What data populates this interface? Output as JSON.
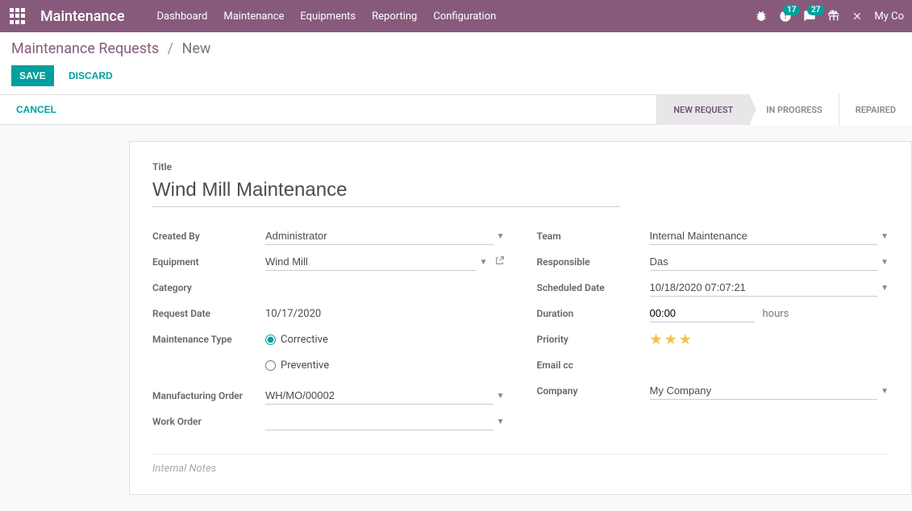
{
  "brand": "Maintenance",
  "nav": {
    "dashboard": "Dashboard",
    "maintenance": "Maintenance",
    "equipments": "Equipments",
    "reporting": "Reporting",
    "configuration": "Configuration"
  },
  "top_badges": {
    "activities": "17",
    "messages": "27"
  },
  "company": "My Co",
  "breadcrumb": {
    "root": "Maintenance Requests",
    "current": "New"
  },
  "buttons": {
    "save": "SAVE",
    "discard": "DISCARD",
    "cancel": "CANCEL"
  },
  "status": {
    "new_request": "NEW REQUEST",
    "in_progress": "IN PROGRESS",
    "repaired": "REPAIRED"
  },
  "form": {
    "title_label": "Title",
    "title": "Wind Mill Maintenance",
    "labels": {
      "created_by": "Created By",
      "equipment": "Equipment",
      "category": "Category",
      "request_date": "Request Date",
      "maintenance_type": "Maintenance Type",
      "manufacturing_order": "Manufacturing Order",
      "work_order": "Work Order",
      "team": "Team",
      "responsible": "Responsible",
      "scheduled_date": "Scheduled Date",
      "duration": "Duration",
      "priority": "Priority",
      "email_cc": "Email cc",
      "company": "Company"
    },
    "values": {
      "created_by": "Administrator",
      "equipment": "Wind Mill",
      "category": "",
      "request_date": "10/17/2020",
      "maintenance_type_corrective": "Corrective",
      "maintenance_type_preventive": "Preventive",
      "manufacturing_order": "WH/MO/00002",
      "work_order": "",
      "team": "Internal Maintenance",
      "responsible": "Das",
      "scheduled_date": "10/18/2020 07:07:21",
      "duration": "00:00",
      "hours": "hours",
      "email_cc": "",
      "company": "My Company"
    },
    "notes_placeholder": "Internal Notes"
  }
}
